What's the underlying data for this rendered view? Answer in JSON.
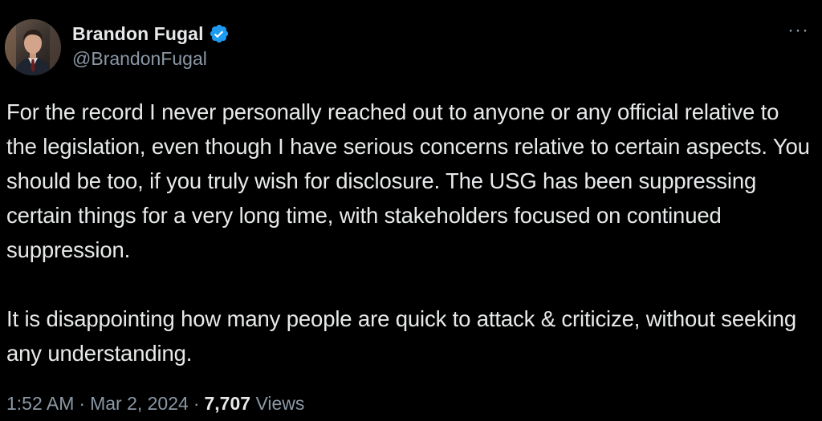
{
  "author": {
    "display_name": "Brandon Fugal",
    "handle": "@BrandonFugal",
    "verified_icon": "verified-badge-icon",
    "avatar": "profile-photo"
  },
  "menu": {
    "more_icon": "more-options-icon",
    "label": "···"
  },
  "tweet": {
    "paragraphs": [
      "For the record I never personally reached out to anyone or any official relative to the legislation, even though I have serious concerns relative to certain aspects. You should be too, if you truly wish for disclosure. The USG has been suppressing certain things for a very long time, with stakeholders focused on continued suppression.",
      "It is disappointing how many people are quick to attack & criticize, without seeking any understanding."
    ]
  },
  "meta": {
    "time": "1:52 AM",
    "separator": "·",
    "date": "Mar 2, 2024",
    "views_count": "7,707",
    "views_label": "Views"
  },
  "colors": {
    "background": "#000000",
    "text": "#e7e9ea",
    "muted": "#8b98a5",
    "verified": "#1d9bf0"
  }
}
